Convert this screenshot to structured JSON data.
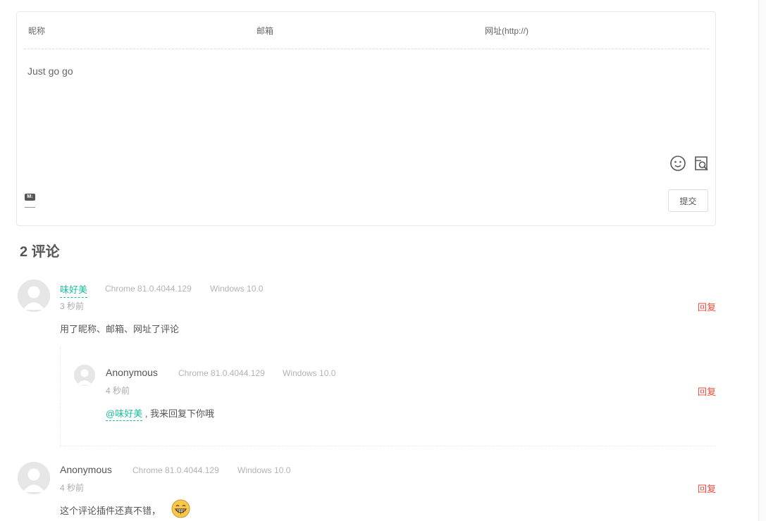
{
  "form": {
    "nick_placeholder": "昵称",
    "mail_placeholder": "邮箱",
    "link_placeholder": "网址(http://)",
    "editor_text": "Just go go",
    "markdown_badge": "M↓",
    "submit_label": "提交"
  },
  "count_label": "2 评论",
  "comments": [
    {
      "nick": "味好美",
      "browser": "Chrome 81.0.4044.129",
      "os": "Windows 10.0",
      "time": "3 秒前",
      "reply_label": "回复",
      "content": "用了昵称、邮箱、网址了评论",
      "child": {
        "nick": "Anonymous",
        "browser": "Chrome 81.0.4044.129",
        "os": "Windows 10.0",
        "time": "4 秒前",
        "reply_label": "回复",
        "at": "@味好美",
        "content": " , 我来回复下你哦"
      }
    },
    {
      "nick": "Anonymous",
      "browser": "Chrome 81.0.4044.129",
      "os": "Windows 10.0",
      "time": "4 秒前",
      "reply_label": "回复",
      "content": "这个评论插件还真不错，",
      "emoji": "grinning-face"
    }
  ],
  "colors": {
    "accent": "#1abc9c",
    "reply": "#e74c3c",
    "meta": "#b3b3b3",
    "border": "#e8e8e8"
  }
}
